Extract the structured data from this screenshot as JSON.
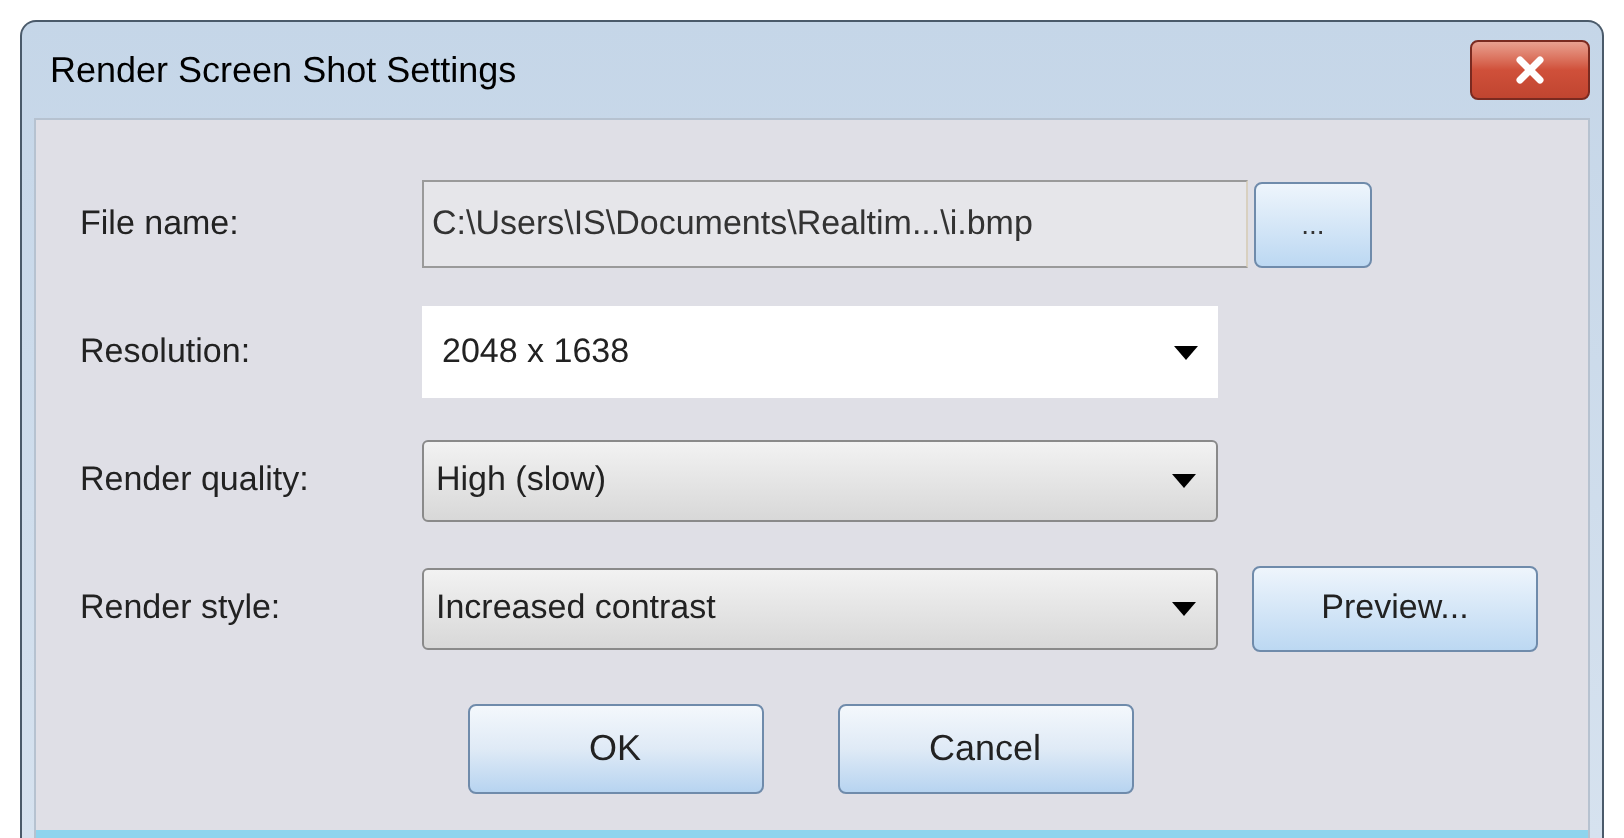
{
  "window": {
    "title": "Render Screen Shot Settings"
  },
  "rows": [
    {
      "label": "File name:",
      "kind": "textbox",
      "value": "C:\\Users\\IS\\Documents\\Realtim...\\i.bmp",
      "button": "..."
    },
    {
      "label": "Resolution:",
      "kind": "combo",
      "value": "2048 x 1638"
    },
    {
      "label": "Render quality:",
      "kind": "dropdown",
      "value": "High (slow)"
    },
    {
      "label": "Render style:",
      "kind": "dropdown",
      "value": "Increased contrast",
      "button": "Preview..."
    }
  ],
  "buttons": [
    "OK",
    "Cancel"
  ]
}
